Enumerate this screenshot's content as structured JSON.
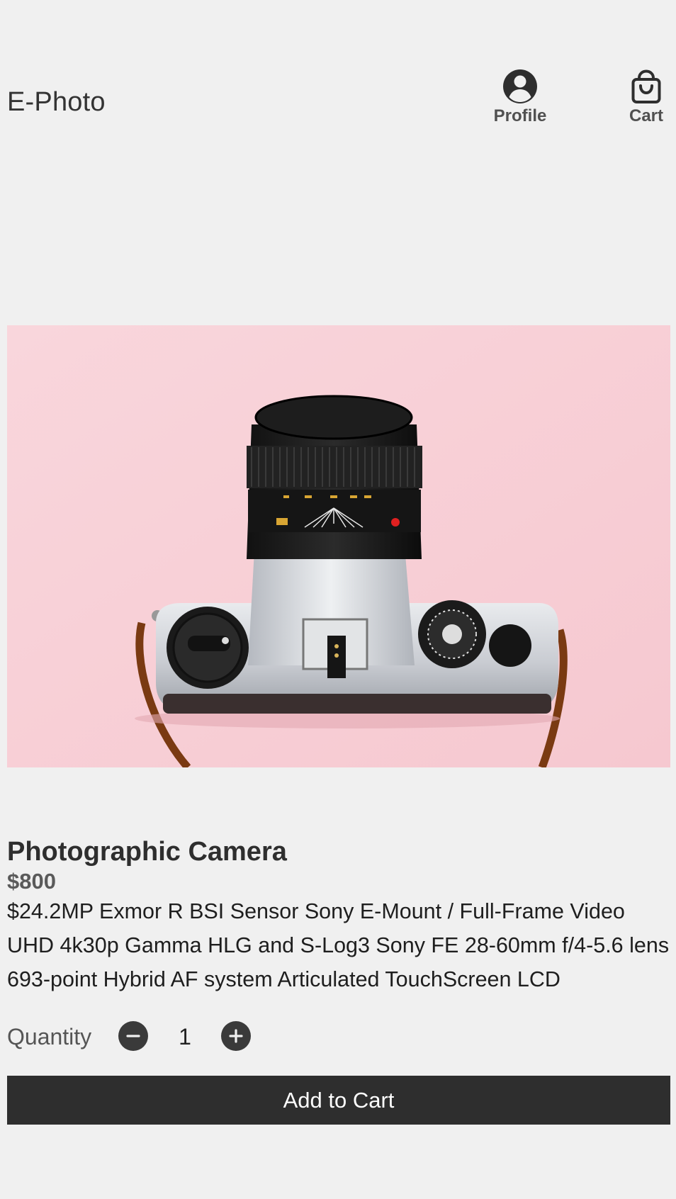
{
  "header": {
    "brand": "E-Photo",
    "profile_label": "Profile",
    "cart_label": "Cart"
  },
  "product": {
    "title": "Photographic Camera",
    "price": "$800",
    "description": "$24.2MP Exmor R BSI Sensor Sony E-Mount / Full-Frame Video UHD 4k30p Gamma HLG and S-Log3 Sony FE 28-60mm f/4-5.6 lens 693-point Hybrid AF system Articulated TouchScreen LCD",
    "image_icon": "camera-photo"
  },
  "quantity": {
    "label": "Quantity",
    "value": "1"
  },
  "actions": {
    "add_to_cart_label": "Add to Cart"
  },
  "colors": {
    "background": "#f0f0f0",
    "button": "#2e2e2e",
    "image_background": "#f8d1d8"
  }
}
